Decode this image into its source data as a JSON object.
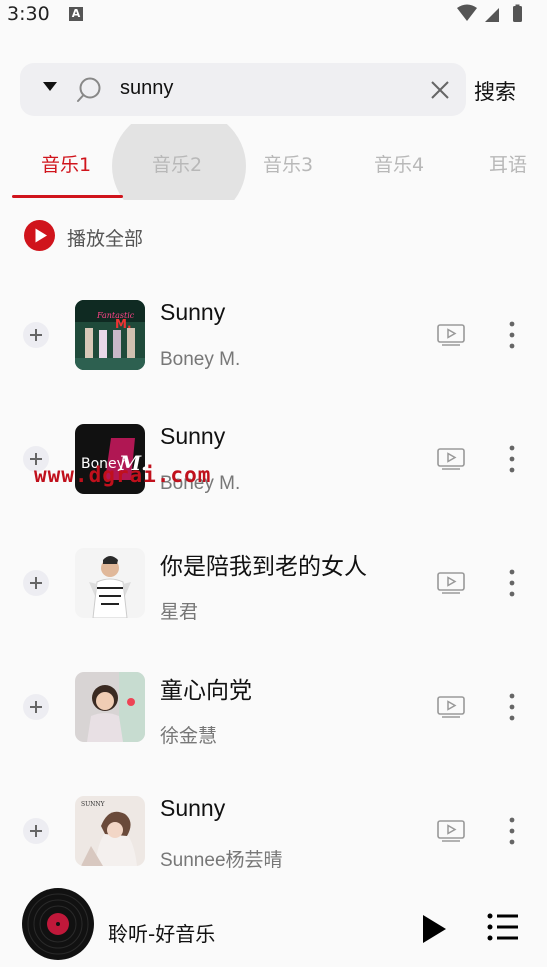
{
  "status_bar": {
    "time": "3:30",
    "notification_icon": "A"
  },
  "search": {
    "query": "sunny",
    "button_label": "搜索"
  },
  "tabs": [
    {
      "label": "音乐1",
      "active": true
    },
    {
      "label": "音乐2",
      "active": false
    },
    {
      "label": "音乐3",
      "active": false
    },
    {
      "label": "音乐4",
      "active": false
    },
    {
      "label": "耳语",
      "active": false
    }
  ],
  "play_all_label": "播放全部",
  "songs": [
    {
      "title": "Sunny",
      "artist": "Boney M.",
      "cover": "boney-m-fantastic-cover"
    },
    {
      "title": "Sunny",
      "artist": "Boney M.",
      "cover": "boney-m-logo-cover"
    },
    {
      "title": "你是陪我到老的女人",
      "artist": "星君",
      "cover": "singer-portrait-cover"
    },
    {
      "title": "童心向党",
      "artist": "徐金慧",
      "cover": "child-portrait-cover"
    },
    {
      "title": "Sunny",
      "artist": "Sunnee杨芸晴",
      "cover": "sunnee-cover"
    }
  ],
  "watermark": "www.dgrai.com",
  "player": {
    "title": "聆听-好音乐"
  },
  "colors": {
    "accent": "#d0141c",
    "background": "#fafafa",
    "search_bg": "#efeff2",
    "inactive_tab": "#b8b8b8"
  }
}
